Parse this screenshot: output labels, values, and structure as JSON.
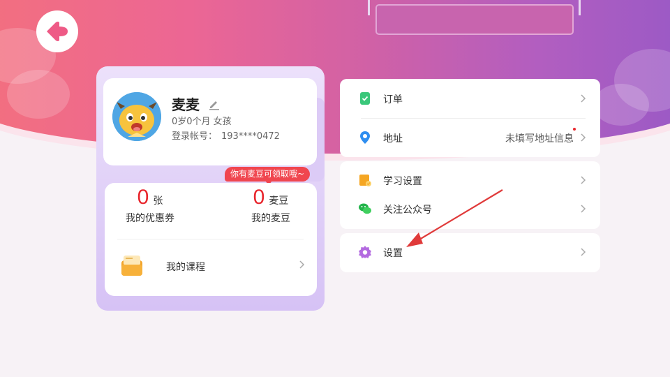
{
  "colors": {
    "accent_red": "#e8262d",
    "header_gradient": [
      "#f3707e",
      "#ec6694",
      "#d061a6",
      "#b25ec0",
      "#9859c6"
    ],
    "card_purple": "#d6c2f5"
  },
  "header": {
    "back_icon": "back-arrow-icon"
  },
  "profile": {
    "name": "麦麦",
    "meta": "0岁0个月  女孩",
    "account_label": "登录帐号：",
    "account_value": "193****0472",
    "promo_bubble": "你有麦豆可领取哦~",
    "coupon": {
      "count": "0",
      "unit": "张",
      "caption": "我的优惠券"
    },
    "bean": {
      "count": "0",
      "unit": "麦豆",
      "caption": "我的麦豆"
    },
    "course_label": "我的课程"
  },
  "menu": {
    "orders": {
      "label": "订单",
      "icon": "order-icon"
    },
    "address": {
      "label": "地址",
      "value": "未填写地址信息",
      "icon": "location-pin-icon"
    },
    "study_settings": {
      "label": "学习设置",
      "icon": "study-book-icon"
    },
    "follow_account": {
      "label": "关注公众号",
      "icon": "wechat-icon"
    },
    "settings": {
      "label": "设置",
      "icon": "gear-icon"
    }
  }
}
